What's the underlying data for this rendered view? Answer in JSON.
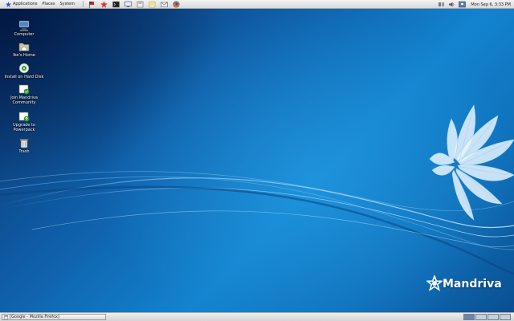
{
  "top_panel": {
    "menus": [
      {
        "label": "Applications",
        "icon": "mandriva-star-icon"
      },
      {
        "label": "Places"
      },
      {
        "label": "System"
      }
    ],
    "launchers": [
      "flag-icon",
      "star-icon",
      "terminal-icon",
      "monitor-icon",
      "disk-icon",
      "notes-icon",
      "mail-icon",
      "firefox-icon"
    ],
    "tray_icons": [
      "network-icon",
      "volume-icon",
      "user-icon"
    ],
    "clock": "Mon Sep 6,  3:33 PM"
  },
  "desktop_icons": [
    {
      "label": "Computer",
      "icon": "computer-icon"
    },
    {
      "label": "Ike's Home",
      "icon": "home-folder-icon"
    },
    {
      "label": "Install on Hard Disk",
      "icon": "installer-icon"
    },
    {
      "label": "Join Mandriva\nCommunity",
      "icon": "community-icon"
    },
    {
      "label": "Upgrade to\nPowerpack",
      "icon": "upgrade-icon"
    },
    {
      "label": "Trash",
      "icon": "trash-icon"
    }
  ],
  "brand": {
    "name": "Mandriva",
    "icon": "mandriva-logo-icon"
  },
  "taskbar": {
    "tasks": [
      {
        "label": "[Google - Mozilla Firefox]",
        "icon": "window-icon"
      }
    ],
    "workspaces": [
      {
        "active": true
      },
      {
        "active": false
      },
      {
        "active": false
      },
      {
        "active": false
      }
    ]
  },
  "colors": {
    "desktop": "#1383cf",
    "panel": "#e4e4e4"
  }
}
